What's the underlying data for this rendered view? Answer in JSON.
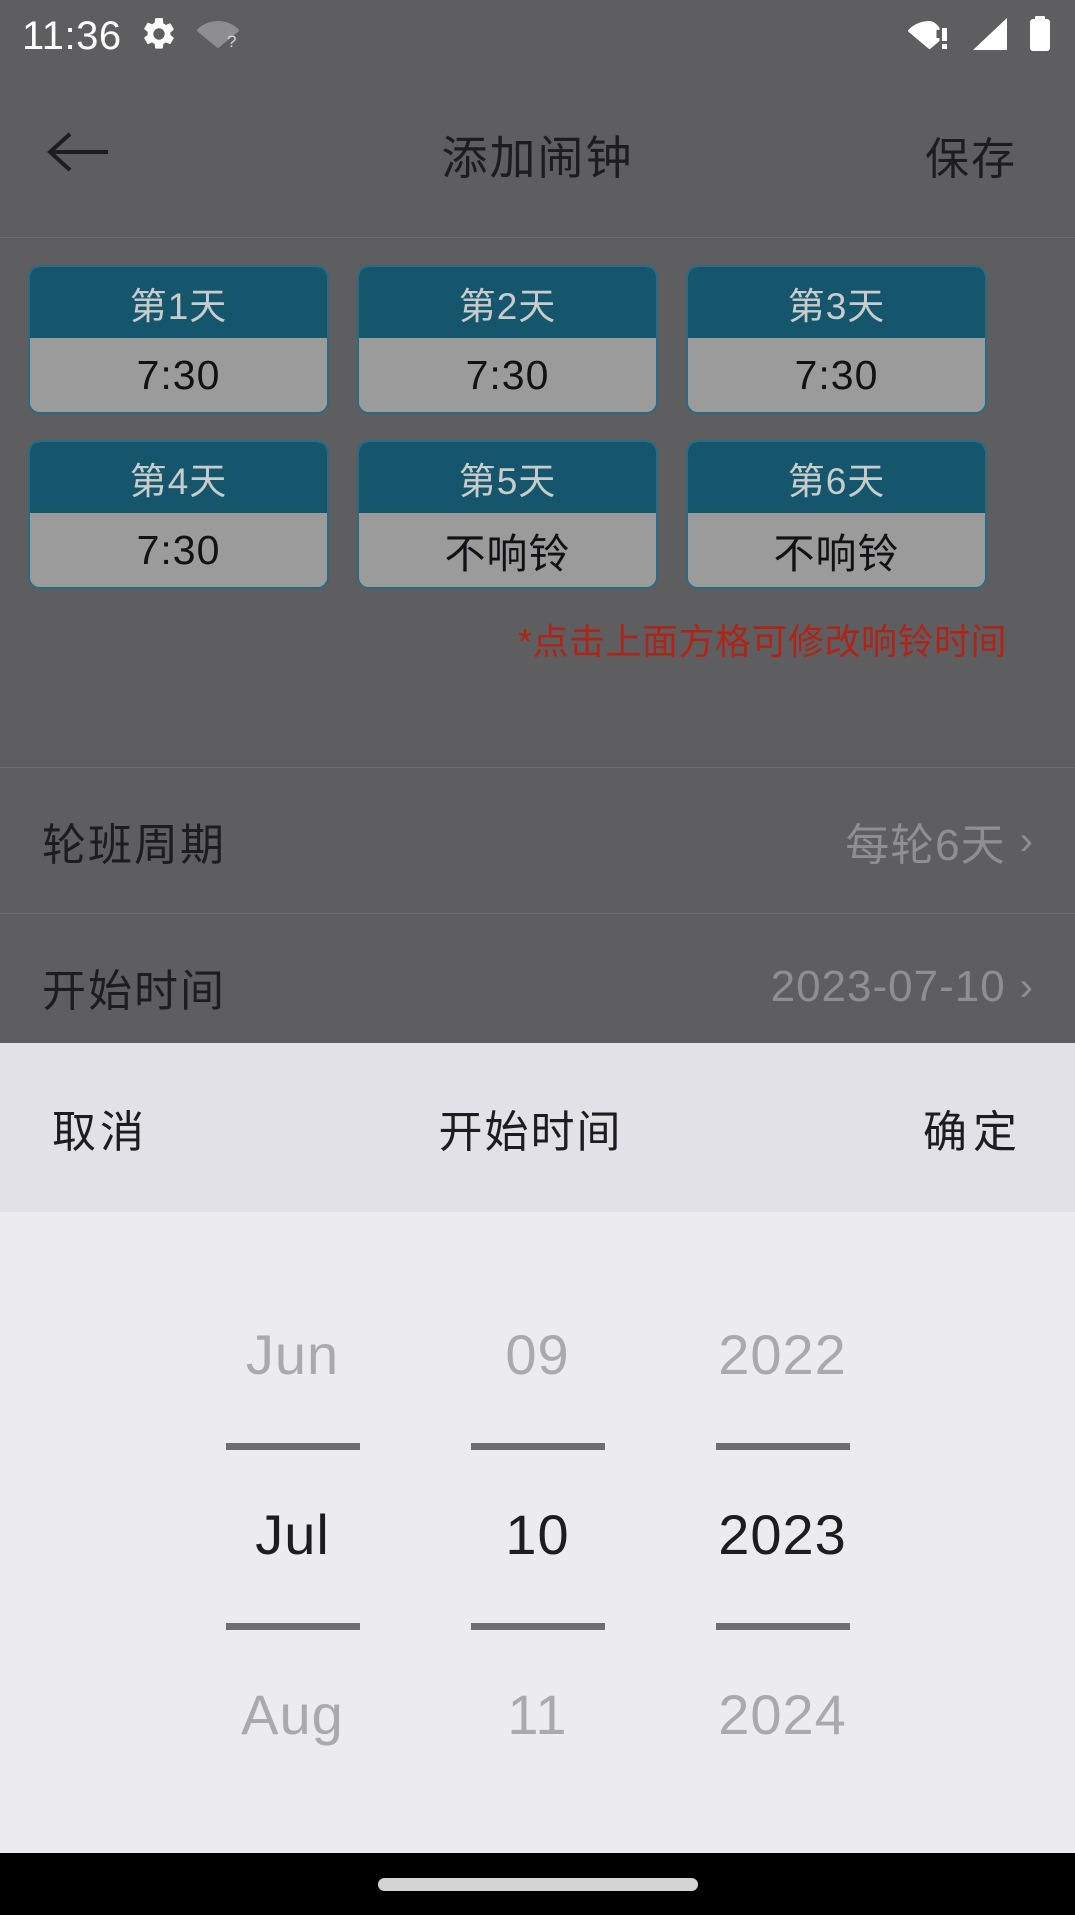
{
  "status_bar": {
    "time": "11:36",
    "icons_left": [
      "gear-icon",
      "wifi-question-icon"
    ],
    "icons_right": [
      "wifi-alert-icon",
      "cellular-signal-icon",
      "battery-icon"
    ]
  },
  "title_bar": {
    "back_icon": "back-arrow-icon",
    "title": "添加闹钟",
    "save_label": "保存"
  },
  "day_cards": {
    "rows": [
      [
        {
          "day_label": "第1天",
          "time": "7:30"
        },
        {
          "day_label": "第2天",
          "time": "7:30"
        },
        {
          "day_label": "第3天",
          "time": "7:30"
        }
      ],
      [
        {
          "day_label": "第4天",
          "time": "7:30"
        },
        {
          "day_label": "第5天",
          "time": "不响铃"
        },
        {
          "day_label": "第6天",
          "time": "不响铃"
        }
      ]
    ],
    "hint": "*点击上面方格可修改响铃时间"
  },
  "settings": {
    "rows": [
      {
        "label": "轮班周期",
        "value": "每轮6天",
        "chevron": "›"
      },
      {
        "label": "开始时间",
        "value": "2023-07-10",
        "chevron": "›"
      }
    ]
  },
  "date_picker": {
    "cancel_label": "取消",
    "title": "开始时间",
    "confirm_label": "确定",
    "columns": [
      {
        "name": "month",
        "above": "Jun",
        "selected": "Jul",
        "below": "Aug"
      },
      {
        "name": "day",
        "above": "09",
        "selected": "10",
        "below": "11"
      },
      {
        "name": "year",
        "above": "2022",
        "selected": "2023",
        "below": "2024"
      }
    ]
  },
  "nav_bar": {
    "pill": "gesture-pill"
  },
  "colors": {
    "app_background": "#5e5e60",
    "card_header": "#16566c",
    "card_border": "#2b6a80",
    "card_body": "#9b9b9b",
    "hint_red": "#b02418",
    "picker_background": "#ebebf0",
    "picker_header": "#e1e1e7",
    "wheel_line": "#6d6d72",
    "nav_background": "#000000"
  }
}
